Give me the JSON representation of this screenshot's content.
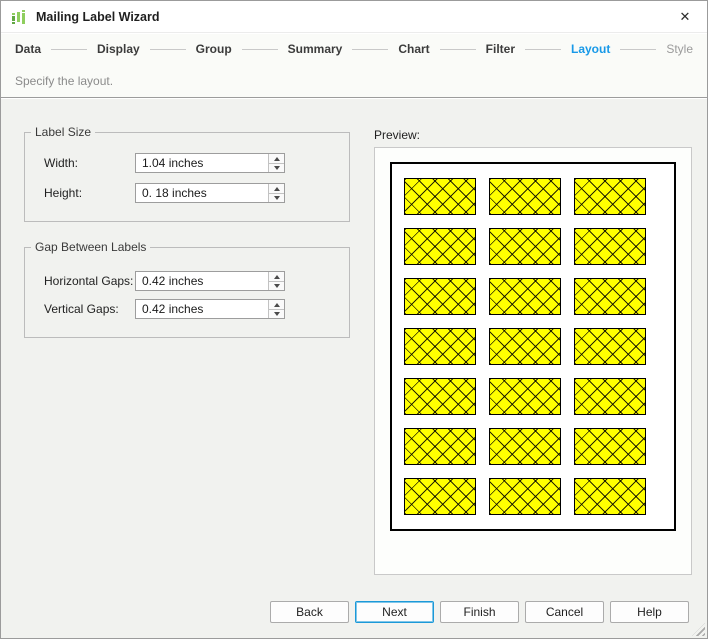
{
  "window": {
    "title": "Mailing Label Wizard",
    "close_label": "✕"
  },
  "steps": {
    "items": [
      {
        "label": "Data",
        "state": "normal"
      },
      {
        "label": "Display",
        "state": "normal"
      },
      {
        "label": "Group",
        "state": "normal"
      },
      {
        "label": "Summary",
        "state": "normal"
      },
      {
        "label": "Chart",
        "state": "normal"
      },
      {
        "label": "Filter",
        "state": "normal"
      },
      {
        "label": "Layout",
        "state": "active"
      },
      {
        "label": "Style",
        "state": "upcoming"
      }
    ]
  },
  "subtitle": "Specify the layout.",
  "form": {
    "label_size": {
      "legend": "Label Size",
      "fields": [
        {
          "label": "Width:",
          "value": "1.04 inches"
        },
        {
          "label": "Height:",
          "value": "0. 18 inches"
        }
      ]
    },
    "gap_between_labels": {
      "legend": "Gap Between Labels",
      "fields": [
        {
          "label": "Horizontal Gaps:",
          "value": "0.42 inches"
        },
        {
          "label": "Vertical Gaps:",
          "value": "0.42 inches"
        }
      ]
    }
  },
  "preview": {
    "caption": "Preview:",
    "grid": {
      "rows": 7,
      "columns": 3
    },
    "label_fill_color": "#ffff00",
    "crosshatch_color": "#000000"
  },
  "buttons": [
    {
      "label": "Back",
      "default": false
    },
    {
      "label": "Next",
      "default": true
    },
    {
      "label": "Finish",
      "default": false
    },
    {
      "label": "Cancel",
      "default": false
    },
    {
      "label": "Help",
      "default": false
    }
  ],
  "colors": {
    "active_step": "#1899e8",
    "upcoming_step": "#9b9b9b",
    "step_text": "#3c3c3c",
    "content_background": "#f1f2ef",
    "default_button_border": "#1b99d8"
  }
}
